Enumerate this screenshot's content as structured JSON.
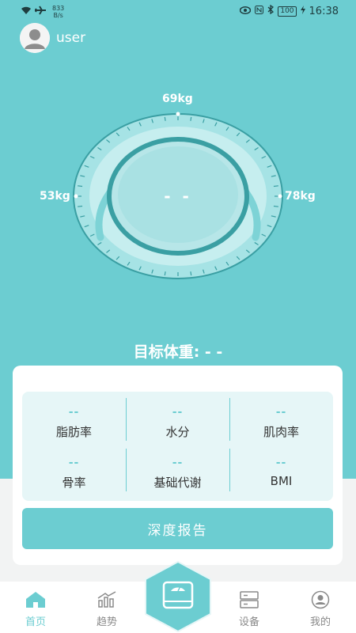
{
  "status_bar": {
    "net_speed_value": "833",
    "net_speed_unit": "B/s",
    "battery": "100",
    "time": "16:38"
  },
  "user": {
    "name": "user"
  },
  "gauge": {
    "top_label": "69kg",
    "left_label": "53kg",
    "right_label": "78kg",
    "center_value": "- -"
  },
  "target": {
    "label": "目标体重: - -"
  },
  "metrics": [
    {
      "value": "--",
      "label": "脂肪率"
    },
    {
      "value": "--",
      "label": "水分"
    },
    {
      "value": "--",
      "label": "肌肉率"
    },
    {
      "value": "--",
      "label": "骨率"
    },
    {
      "value": "--",
      "label": "基础代谢"
    },
    {
      "value": "--",
      "label": "BMI"
    }
  ],
  "report_button": "深度报告",
  "tabs": [
    {
      "label": "首页",
      "icon": "home-icon"
    },
    {
      "label": "趋势",
      "icon": "chart-icon"
    },
    {
      "label": "设备",
      "icon": "device-icon"
    },
    {
      "label": "我的",
      "icon": "profile-icon"
    }
  ],
  "colors": {
    "accent": "#6ccdd1",
    "accent_dark": "#3a9fa3",
    "background": "#f2f3f3"
  }
}
